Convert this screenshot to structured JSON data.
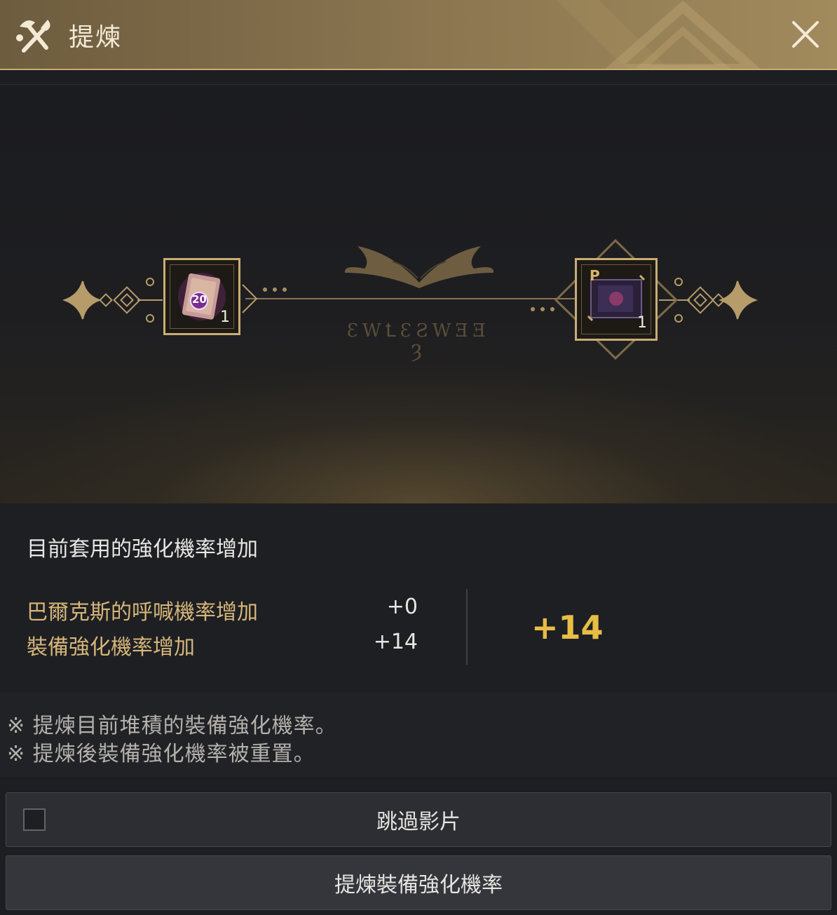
{
  "window": {
    "title": "提煉",
    "title_icon": "refine-tools-icon",
    "close_icon": "close-icon"
  },
  "stage": {
    "rune_text": "ƐWꝈƐƧWƎƎ Ȝ",
    "source_item": {
      "count": "1",
      "badge": "20",
      "icon": "enhancement-book-icon"
    },
    "result_item": {
      "count": "1",
      "icon": "scroll-icon",
      "badge": "P"
    }
  },
  "stats": {
    "heading": "目前套用的強化機率增加",
    "rows": [
      {
        "label": "巴爾克斯的呼喊機率增加",
        "value": "+0"
      },
      {
        "label": "裝備強化機率增加",
        "value": "+14"
      }
    ],
    "total": "+14"
  },
  "notes": [
    "※ 提煉目前堆積的裝備強化機率。",
    "※ 提煉後裝備強化機率被重置。"
  ],
  "buttons": {
    "skip_video": "跳過影片",
    "skip_checked": false,
    "refine": "提煉裝備強化機率"
  },
  "colors": {
    "accent_gold": "#e8bd45",
    "label_gold": "#d6b679",
    "titlebar": "#8a7550"
  }
}
